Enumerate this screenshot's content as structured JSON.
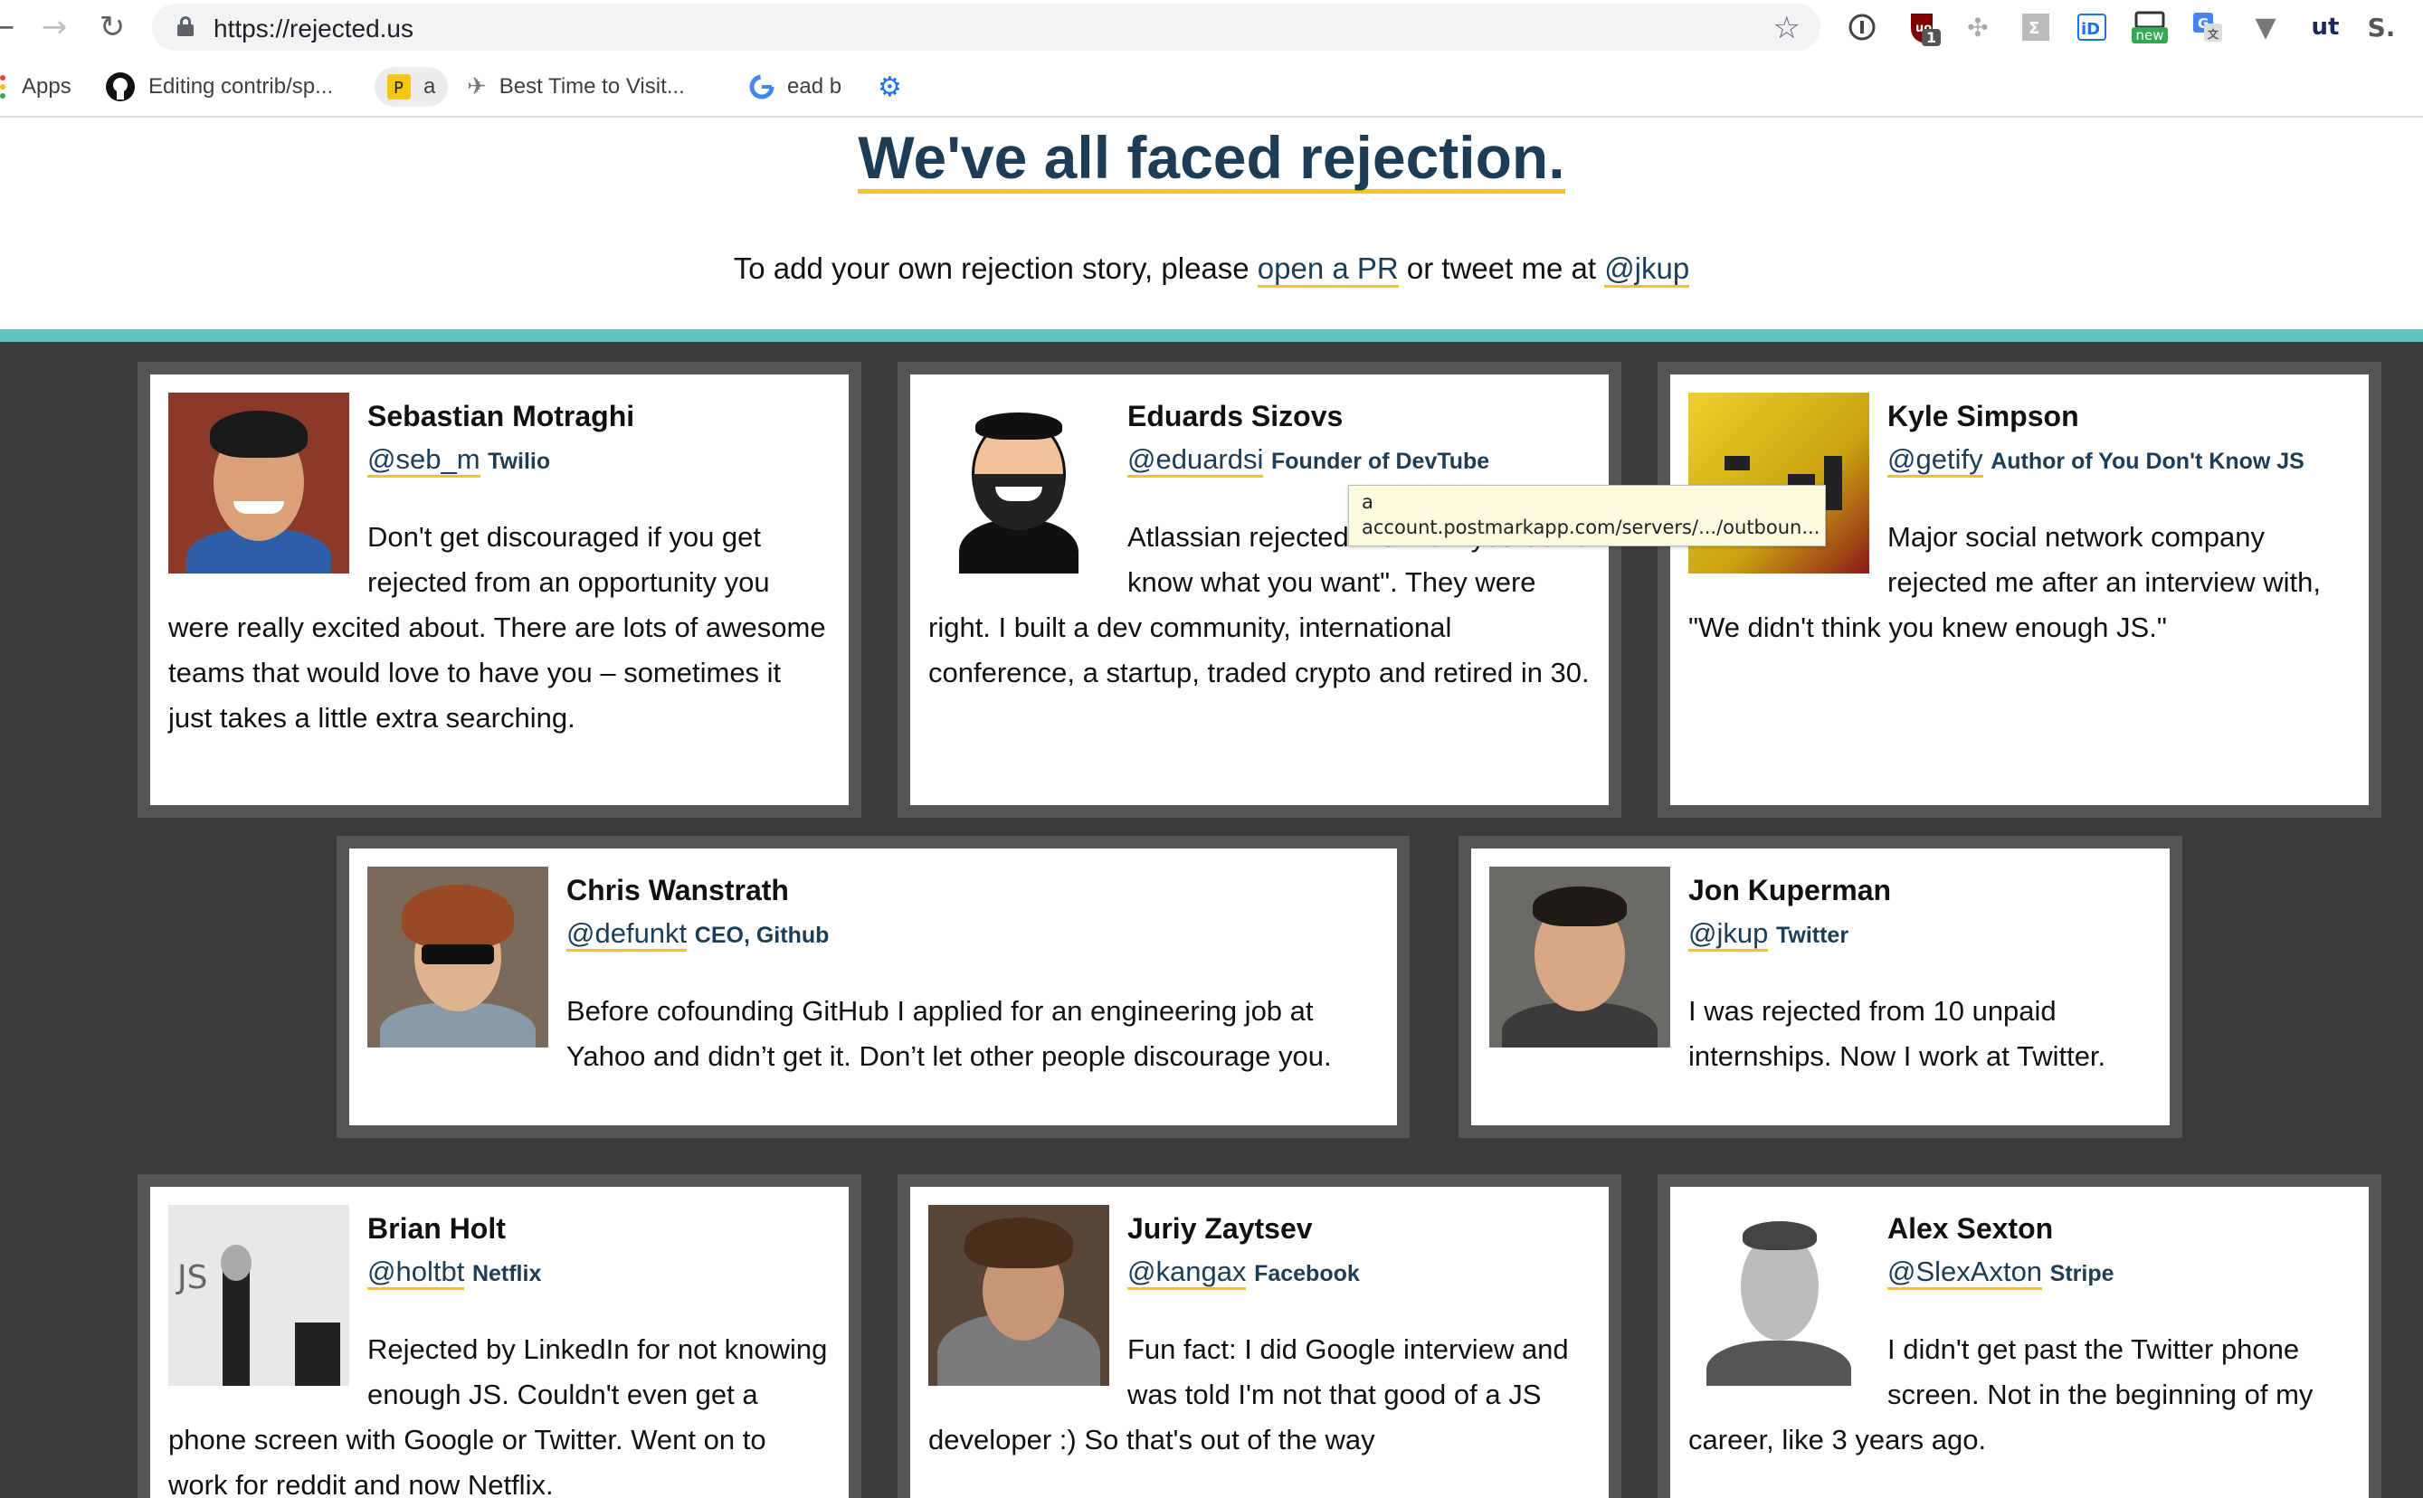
{
  "browser": {
    "url": "https://rejected.us",
    "ext_badge_count": "1",
    "ext_new_label": "new",
    "ext_letter": "S."
  },
  "bookmarks": [
    {
      "label": "Apps"
    },
    {
      "label": "Editing contrib/sp..."
    },
    {
      "label": "a"
    },
    {
      "label": "Best Time to Visit..."
    },
    {
      "label": "ead b"
    }
  ],
  "page": {
    "title": "We've all faced rejection.",
    "intro_prefix": "To add your own rejection story, please ",
    "intro_link_pr": "open a PR",
    "intro_middle": " or tweet me at ",
    "intro_link_twitter": "@jkup"
  },
  "stories": [
    {
      "name": "Sebastian Motraghi",
      "handle": "@seb_m",
      "company": "Twilio",
      "quote": "Don't get discouraged if you get rejected from an opportunity you were really excited about. There are lots of awesome teams that would love to have you – sometimes it just takes a little extra searching."
    },
    {
      "name": "Eduards Sizovs",
      "handle": "@eduardsi",
      "company": "Founder of DevTube",
      "quote": "Atlassian rejected me with \"you don't know what you want\". They were right. I built a dev community, international conference, a startup, traded crypto and retired in 30."
    },
    {
      "name": "Kyle Simpson",
      "handle": "@getify",
      "company": "Author of You Don't Know JS",
      "quote": "Major social network company rejected me after an interview with, \"We didn't think you knew enough JS.\""
    },
    {
      "name": "Chris Wanstrath",
      "handle": "@defunkt",
      "company": "CEO, Github",
      "quote": "Before cofounding GitHub I applied for an engineering job at Yahoo and didn’t get it. Don’t let other people discourage you."
    },
    {
      "name": "Jon Kuperman",
      "handle": "@jkup",
      "company": "Twitter",
      "quote": "I was rejected from 10 unpaid internships. Now I work at Twitter."
    },
    {
      "name": "Brian Holt",
      "handle": "@holtbt",
      "company": "Netflix",
      "quote": "Rejected by LinkedIn for not knowing enough JS. Couldn't even get a phone screen with Google or Twitter. Went on to work for reddit and now Netflix."
    },
    {
      "name": "Juriy Zaytsev",
      "handle": "@kangax",
      "company": "Facebook",
      "quote": "Fun fact: I did Google interview and was told I'm not that good of a JS developer :) So that's out of the way"
    },
    {
      "name": "Alex Sexton",
      "handle": "@SlexAxton",
      "company": "Stripe",
      "quote": "I didn't get past the Twitter phone screen. Not in the beginning of my career, like 3 years ago."
    }
  ],
  "tooltip": {
    "line1": "a",
    "line2": "account.postmarkapp.com/servers/.../outboun..."
  },
  "colors": {
    "heading": "#1d3d56",
    "underline": "#f5c518",
    "teal_bar": "#5ec4c0",
    "grid_bg": "#3b3b3b"
  }
}
